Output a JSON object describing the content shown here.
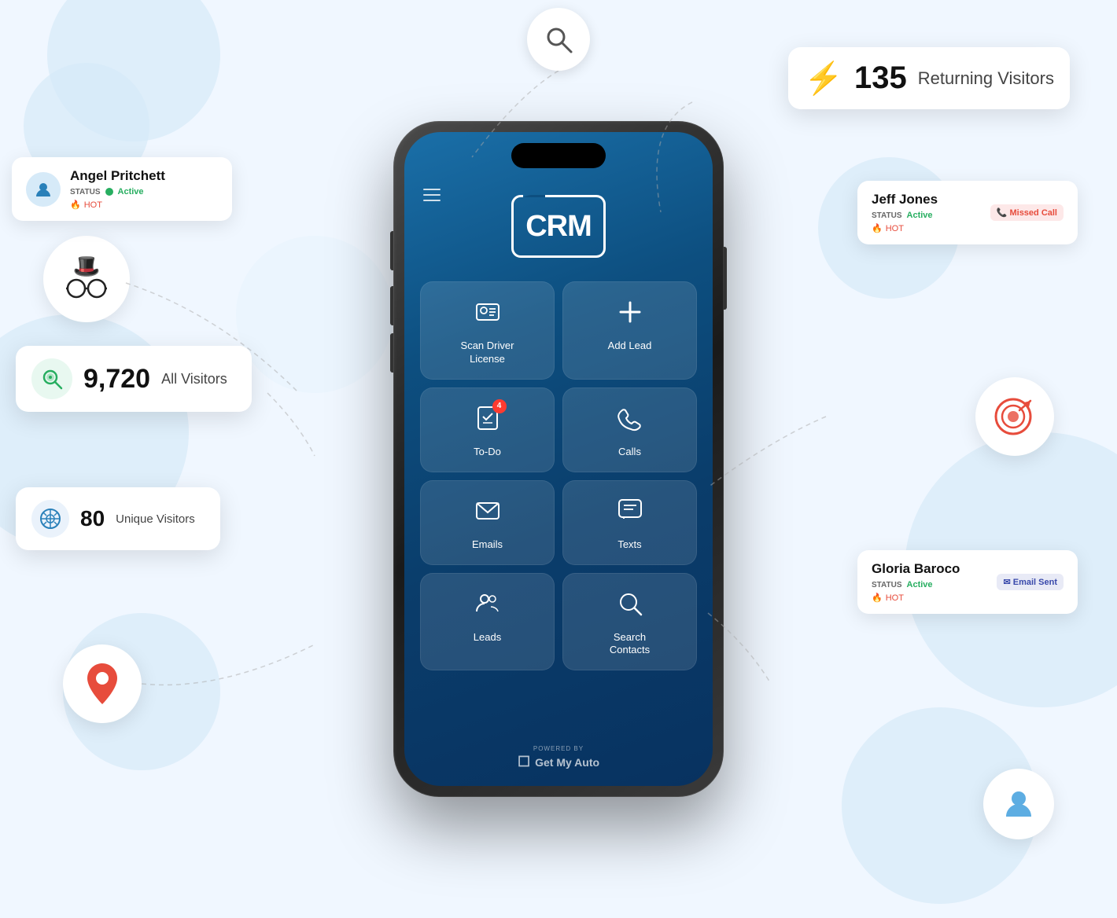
{
  "background": {
    "color": "#f0f7ff"
  },
  "phone": {
    "screen_bg_start": "#1a6fa8",
    "screen_bg_end": "#083260",
    "logo_text": "CRM",
    "footer_powered": "POWERED BY",
    "footer_brand": "Get My Auto"
  },
  "app_buttons": [
    {
      "id": "scan-driver-license",
      "label": "Scan Driver\nLicense",
      "icon": "🪪"
    },
    {
      "id": "add-lead",
      "label": "Add Lead",
      "icon": "+"
    },
    {
      "id": "to-do",
      "label": "To-Do",
      "icon": "☑",
      "badge": "4"
    },
    {
      "id": "calls",
      "label": "Calls",
      "icon": "📞"
    },
    {
      "id": "emails",
      "label": "Emails",
      "icon": "✉"
    },
    {
      "id": "texts",
      "label": "Texts",
      "icon": "💬"
    },
    {
      "id": "leads",
      "label": "Leads",
      "icon": "👥"
    },
    {
      "id": "search-contacts",
      "label": "Search\nContacts",
      "icon": "🔍"
    }
  ],
  "floating_stats": [
    {
      "id": "returning-visitors",
      "number": "135",
      "label": "Returning Visitors",
      "icon": "⚡",
      "icon_color": "#f39c12"
    },
    {
      "id": "all-visitors",
      "number": "9,720",
      "label": "All Visitors",
      "icon": "search-green"
    },
    {
      "id": "unique-visitors",
      "number": "80",
      "label": "Unique Visitors",
      "icon": "target-blue"
    }
  ],
  "contact_cards": [
    {
      "id": "angel-pritchett",
      "name": "Angel Pritchett",
      "status_label": "STATUS",
      "status_value": "Active",
      "tag": "HOT",
      "action": null
    },
    {
      "id": "jeff-jones",
      "name": "Jeff Jones",
      "status_label": "STATUS",
      "status_value": "Active",
      "tag": "HOT",
      "action": "Missed Call",
      "action_type": "missed-call"
    },
    {
      "id": "gloria-baroco",
      "name": "Gloria Baroco",
      "status_label": "STATUS",
      "status_value": "Active",
      "tag": "HOT",
      "action": "Email Sent",
      "action_type": "email-sent"
    }
  ]
}
